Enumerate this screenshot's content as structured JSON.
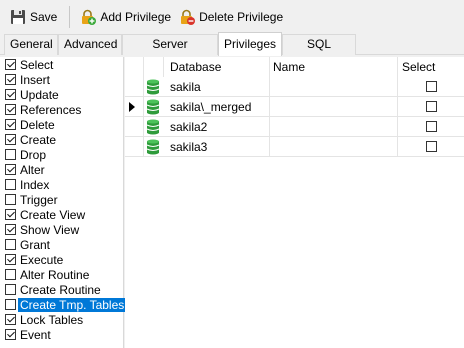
{
  "toolbar": {
    "save_label": "Save",
    "add_privilege_label": "Add Privilege",
    "delete_privilege_label": "Delete Privilege"
  },
  "tabs": [
    {
      "label": "General",
      "active": false
    },
    {
      "label": "Advanced",
      "active": false
    },
    {
      "label": "Server Privileges",
      "active": false
    },
    {
      "label": "Privileges",
      "active": true
    },
    {
      "label": "SQL Preview",
      "active": false
    }
  ],
  "privileges": [
    {
      "label": "Select",
      "checked": true,
      "selected": false
    },
    {
      "label": "Insert",
      "checked": true,
      "selected": false
    },
    {
      "label": "Update",
      "checked": true,
      "selected": false
    },
    {
      "label": "References",
      "checked": true,
      "selected": false
    },
    {
      "label": "Delete",
      "checked": true,
      "selected": false
    },
    {
      "label": "Create",
      "checked": true,
      "selected": false
    },
    {
      "label": "Drop",
      "checked": false,
      "selected": false
    },
    {
      "label": "Alter",
      "checked": true,
      "selected": false
    },
    {
      "label": "Index",
      "checked": false,
      "selected": false
    },
    {
      "label": "Trigger",
      "checked": false,
      "selected": false
    },
    {
      "label": "Create View",
      "checked": true,
      "selected": false
    },
    {
      "label": "Show View",
      "checked": true,
      "selected": false
    },
    {
      "label": "Grant",
      "checked": false,
      "selected": false
    },
    {
      "label": "Execute",
      "checked": true,
      "selected": false
    },
    {
      "label": "Alter Routine",
      "checked": false,
      "selected": false
    },
    {
      "label": "Create Routine",
      "checked": false,
      "selected": false
    },
    {
      "label": "Create Tmp. Tables",
      "checked": false,
      "selected": true
    },
    {
      "label": "Lock Tables",
      "checked": true,
      "selected": false
    },
    {
      "label": "Event",
      "checked": true,
      "selected": false
    }
  ],
  "grid": {
    "columns": [
      "Database",
      "Name",
      "Select"
    ],
    "rows": [
      {
        "database": "sakila",
        "name": "",
        "select": false,
        "current": false
      },
      {
        "database": "sakila\\_merged",
        "name": "",
        "select": false,
        "current": true
      },
      {
        "database": "sakila2",
        "name": "",
        "select": false,
        "current": false
      },
      {
        "database": "sakila3",
        "name": "",
        "select": false,
        "current": false
      }
    ]
  },
  "colors": {
    "selection": "#0078d7",
    "db_icon": "#2e9b3a",
    "lock_icon": "#e8a317",
    "add_badge": "#3aa83a",
    "delete_badge": "#d9342b"
  }
}
